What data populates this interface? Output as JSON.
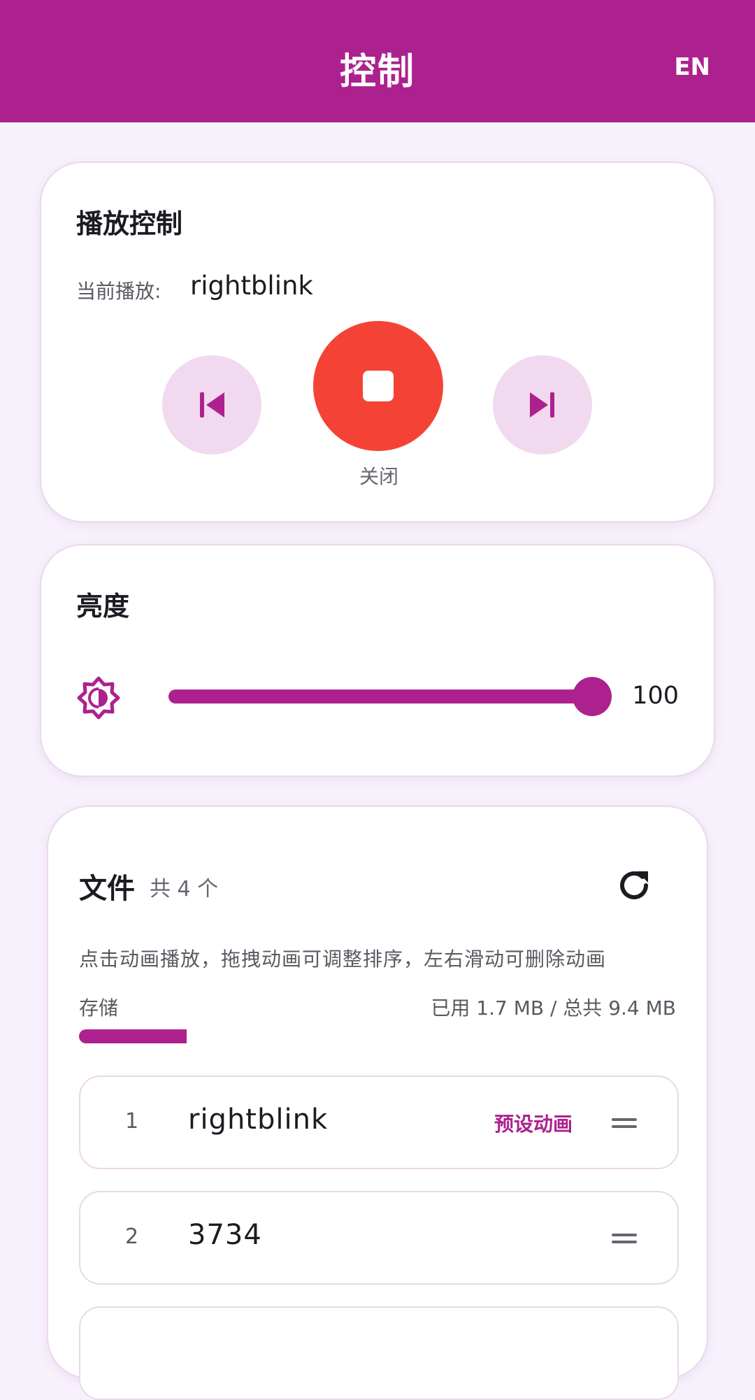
{
  "appbar": {
    "title": "控制",
    "language_button": "EN"
  },
  "playback": {
    "title": "播放控制",
    "now_playing_label": "当前播放:",
    "now_playing_value": "rightblink",
    "stop_label": "关闭"
  },
  "brightness": {
    "title": "亮度",
    "value": "100",
    "level_percent": 100
  },
  "files": {
    "title": "文件",
    "count_label": "共 4 个",
    "hint": "点击动画播放，拖拽动画可调整排序，左右滑动可删除动画",
    "storage_label": "存储",
    "storage_value": "已用 1.7 MB / 总共 9.4 MB",
    "storage_used_fraction": 0.18,
    "items": [
      {
        "index": "1",
        "name": "rightblink",
        "badge": "预设动画"
      },
      {
        "index": "2",
        "name": "3734",
        "badge": ""
      }
    ]
  },
  "colors": {
    "primary": "#ad218e",
    "stop": "#f44336",
    "background": "#f7f1fc",
    "button_tonal": "#f1d9ef"
  },
  "icons": {
    "previous": "skip-previous-icon",
    "stop": "stop-icon",
    "next": "skip-next-icon",
    "brightness": "brightness-icon",
    "refresh": "refresh-icon",
    "drag": "drag-handle-icon"
  }
}
